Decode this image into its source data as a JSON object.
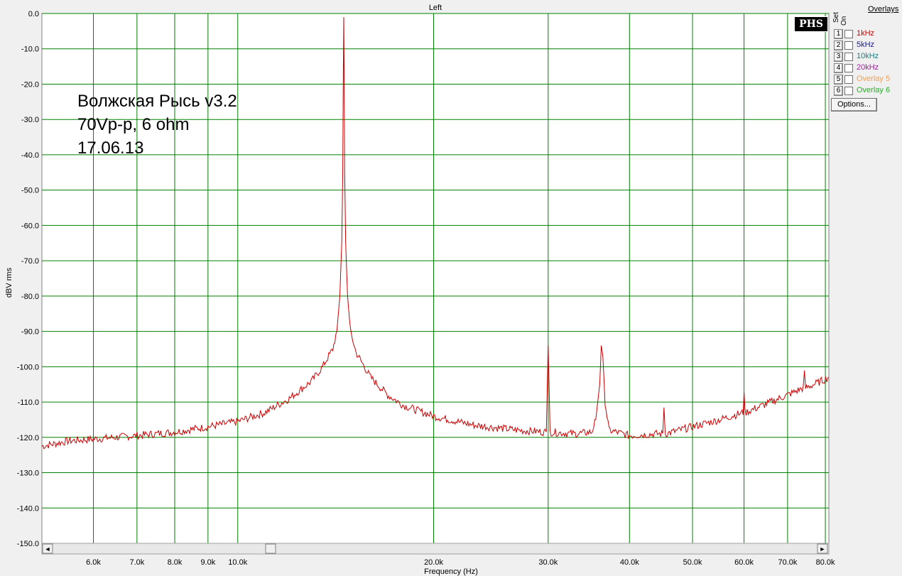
{
  "window_title": "Left",
  "logo_text": "PHS",
  "annotation_lines": [
    "Волжская Рысь v3.2",
    "70Vp-p, 6 ohm",
    "17.06.13"
  ],
  "overlays": {
    "title": "Overlays",
    "set_label": "Set",
    "on_label": "On",
    "options_label": "Options...",
    "items": [
      {
        "num": "1",
        "label": "1kHz",
        "color": "#cc0000"
      },
      {
        "num": "2",
        "label": "5kHz",
        "color": "#1a1a8c"
      },
      {
        "num": "3",
        "label": "10kHz",
        "color": "#1a8080"
      },
      {
        "num": "4",
        "label": "20kHz",
        "color": "#a020a0"
      },
      {
        "num": "5",
        "label": "Overlay 5",
        "color": "#f0a050"
      },
      {
        "num": "6",
        "label": "Overlay 6",
        "color": "#20b020"
      }
    ]
  },
  "scrollbar": {
    "left_arrow": "◄",
    "right_arrow": "►"
  },
  "chart_data": {
    "type": "line",
    "title": "Left",
    "xlabel": "Frequency (Hz)",
    "ylabel": "dBV rms",
    "x_scale": "log",
    "xlim": [
      5000,
      81000
    ],
    "ylim": [
      -150,
      0
    ],
    "grid": true,
    "line_color": "#cc0000",
    "grid_color": "#008000",
    "x_ticks": [
      {
        "v": 6000,
        "label": "6.0k"
      },
      {
        "v": 7000,
        "label": "7.0k"
      },
      {
        "v": 8000,
        "label": "8.0k"
      },
      {
        "v": 9000,
        "label": "9.0k"
      },
      {
        "v": 10000,
        "label": "10.0k"
      },
      {
        "v": 20000,
        "label": "20.0k"
      },
      {
        "v": 30000,
        "label": "30.0k"
      },
      {
        "v": 40000,
        "label": "40.0k"
      },
      {
        "v": 50000,
        "label": "50.0k"
      },
      {
        "v": 60000,
        "label": "60.0k"
      },
      {
        "v": 70000,
        "label": "70.0k"
      },
      {
        "v": 80000,
        "label": "80.0k"
      }
    ],
    "y_ticks": [
      {
        "v": 0,
        "label": "0.0"
      },
      {
        "v": -10,
        "label": "-10.0"
      },
      {
        "v": -20,
        "label": "-20.0"
      },
      {
        "v": -30,
        "label": "-30.0"
      },
      {
        "v": -40,
        "label": "-40.0"
      },
      {
        "v": -50,
        "label": "-50.0"
      },
      {
        "v": -60,
        "label": "-60.0"
      },
      {
        "v": -70,
        "label": "-70.0"
      },
      {
        "v": -80,
        "label": "-80.0"
      },
      {
        "v": -90,
        "label": "-90.0"
      },
      {
        "v": -100,
        "label": "-100.0"
      },
      {
        "v": -110,
        "label": "-110.0"
      },
      {
        "v": -120,
        "label": "-120.0"
      },
      {
        "v": -130,
        "label": "-130.0"
      },
      {
        "v": -140,
        "label": "-140.0"
      },
      {
        "v": -150,
        "label": "-150.0"
      }
    ],
    "series": [
      {
        "values": [
          [
            5000,
            -122.5
          ],
          [
            5500,
            -121
          ],
          [
            6000,
            -120.5
          ],
          [
            7000,
            -119.5
          ],
          [
            8000,
            -118.5
          ],
          [
            9000,
            -117
          ],
          [
            10000,
            -115.5
          ],
          [
            11000,
            -113
          ],
          [
            12000,
            -109
          ],
          [
            13000,
            -104
          ],
          [
            13500,
            -100
          ],
          [
            14000,
            -95
          ],
          [
            14200,
            -90
          ],
          [
            14350,
            -80
          ],
          [
            14450,
            -65
          ],
          [
            14500,
            -45
          ],
          [
            14530,
            -16
          ],
          [
            14550,
            -1
          ],
          [
            14570,
            -16
          ],
          [
            14600,
            -45
          ],
          [
            14650,
            -65
          ],
          [
            14750,
            -80
          ],
          [
            14900,
            -90
          ],
          [
            15200,
            -96
          ],
          [
            16000,
            -103
          ],
          [
            17000,
            -108
          ],
          [
            18000,
            -111
          ],
          [
            20000,
            -114
          ],
          [
            23000,
            -116.5
          ],
          [
            27000,
            -118
          ],
          [
            29800,
            -118.5
          ],
          [
            30000,
            -94
          ],
          [
            30200,
            -118.5
          ],
          [
            33000,
            -119
          ],
          [
            35000,
            -118.5
          ],
          [
            35500,
            -115
          ],
          [
            36000,
            -105
          ],
          [
            36200,
            -95
          ],
          [
            36400,
            -97
          ],
          [
            36700,
            -110
          ],
          [
            37200,
            -118
          ],
          [
            40000,
            -119.5
          ],
          [
            44000,
            -119
          ],
          [
            45000,
            -119
          ],
          [
            45200,
            -111
          ],
          [
            45400,
            -119
          ],
          [
            50000,
            -117
          ],
          [
            55000,
            -115
          ],
          [
            59800,
            -113
          ],
          [
            60000,
            -106.5
          ],
          [
            60200,
            -113
          ],
          [
            65000,
            -110.5
          ],
          [
            70000,
            -108
          ],
          [
            74000,
            -106
          ],
          [
            74300,
            -102
          ],
          [
            74600,
            -106
          ],
          [
            78000,
            -104.5
          ],
          [
            81000,
            -103
          ]
        ]
      }
    ]
  }
}
